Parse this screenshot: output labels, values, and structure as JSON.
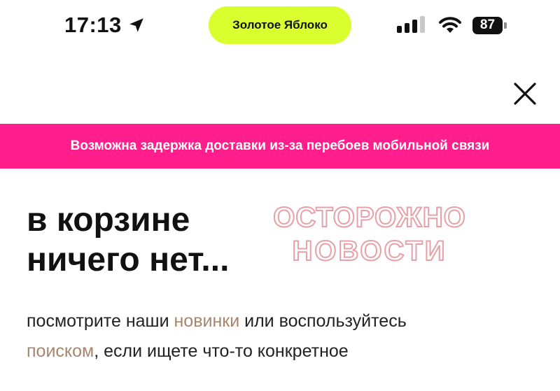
{
  "colors": {
    "accent": "#ff1e8c",
    "pill": "#d9ff2e",
    "link": "#a8856e",
    "watermark": "#e8a0a8"
  },
  "status_bar": {
    "time": "17:13",
    "location_icon": "location-arrow-icon",
    "dynamic_island_text": "Золотое Яблоко",
    "signal_icon": "cellular-signal-icon",
    "wifi_icon": "wifi-icon",
    "battery_level": "87"
  },
  "header": {
    "close_icon": "close-icon"
  },
  "banner": {
    "text": "Возможна задержка доставки из-за перебоев мобильной связи"
  },
  "main": {
    "heading_line1": "в корзине",
    "heading_line2": "ничего нет...",
    "body_part1": "посмотрите наши ",
    "link_new": "новинки",
    "body_part2": " или воспользуйтесь",
    "link_search": "поиском",
    "body_part3": ", если ищете что-то конкретное"
  },
  "watermark": {
    "line1": "ОСТОРОЖНО",
    "line2": "НОВОСТИ"
  }
}
